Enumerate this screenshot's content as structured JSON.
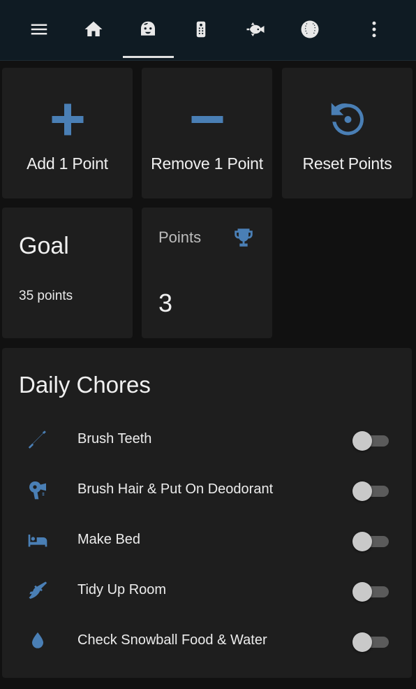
{
  "nav": {
    "icons": [
      "menu-icon",
      "home-icon",
      "kid-face-icon",
      "remote-icon",
      "fish-icon",
      "baseball-icon",
      "more-vertical-icon"
    ],
    "active_tab": "kid-face-icon"
  },
  "buttons": {
    "add": "Add 1 Point",
    "remove": "Remove 1 Point",
    "reset": "Reset Points"
  },
  "goal": {
    "title": "Goal",
    "value": "35 points"
  },
  "points": {
    "label": "Points",
    "value": "3",
    "icon": "trophy-icon"
  },
  "chores": {
    "title": "Daily Chores",
    "items": [
      {
        "label": "Brush Teeth",
        "icon": "toothbrush-icon",
        "on": false
      },
      {
        "label": "Brush Hair & Put On Deodorant",
        "icon": "hair-dryer-icon",
        "on": false
      },
      {
        "label": "Make Bed",
        "icon": "bed-icon",
        "on": false
      },
      {
        "label": "Tidy Up Room",
        "icon": "broom-icon",
        "on": false
      },
      {
        "label": "Check Snowball Food & Water",
        "icon": "water-drop-icon",
        "on": false
      }
    ]
  },
  "colors": {
    "accent": "#4a7fb5",
    "card": "#1e1e1e",
    "header": "#0f1b23",
    "background": "#111111"
  }
}
